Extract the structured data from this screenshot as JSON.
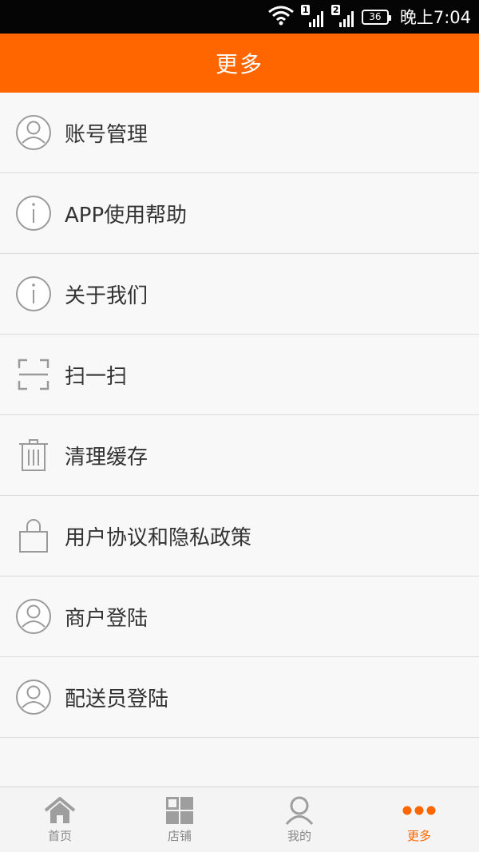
{
  "status_bar": {
    "sim1": "1",
    "sim2": "2",
    "battery": "36",
    "time": "晚上7:04"
  },
  "header": {
    "title": "更多"
  },
  "menu": [
    {
      "label": "账号管理",
      "icon": "user-icon"
    },
    {
      "label": "APP使用帮助",
      "icon": "info-icon"
    },
    {
      "label": "关于我们",
      "icon": "info-icon"
    },
    {
      "label": "扫一扫",
      "icon": "scan-icon"
    },
    {
      "label": "清理缓存",
      "icon": "trash-icon"
    },
    {
      "label": "用户协议和隐私政策",
      "icon": "lock-icon"
    },
    {
      "label": "商户登陆",
      "icon": "user-icon"
    },
    {
      "label": "配送员登陆",
      "icon": "user-icon"
    }
  ],
  "tabs": [
    {
      "label": "首页",
      "icon": "home-icon"
    },
    {
      "label": "店铺",
      "icon": "grid-icon"
    },
    {
      "label": "我的",
      "icon": "person-icon"
    },
    {
      "label": "更多",
      "icon": "more-dots-icon",
      "active": true
    }
  ],
  "colors": {
    "accent": "#ff6600",
    "icon_gray": "#9a9a9a",
    "tab_inactive": "#9e9e9e"
  }
}
